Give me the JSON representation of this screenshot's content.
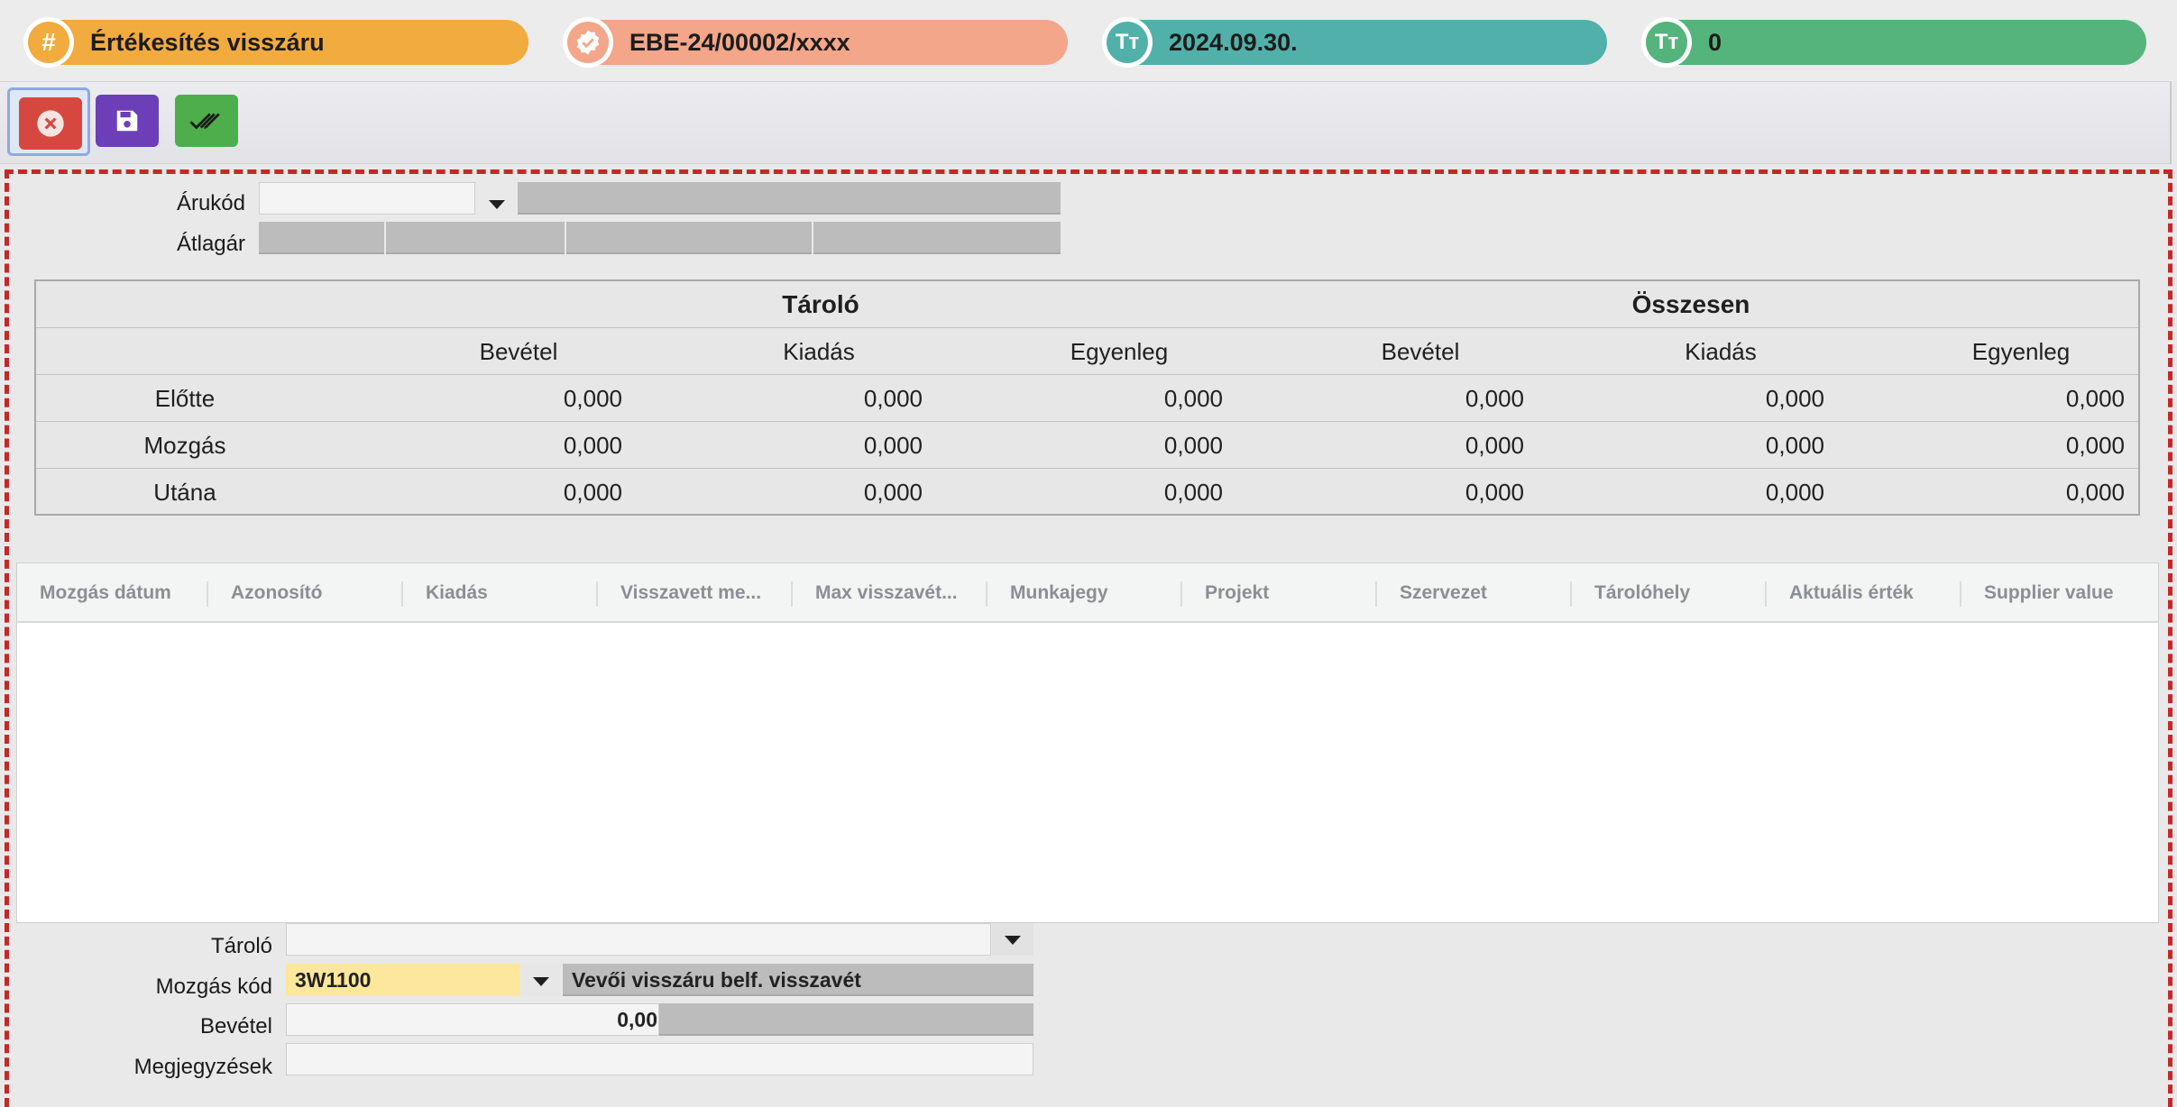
{
  "header": {
    "doc_type": "Értékesítés visszáru",
    "doc_number": "EBE-24/00002/xxxx",
    "date": "2024.09.30.",
    "count": "0",
    "colors": {
      "doc_type": "#f2ab3f",
      "doc_number": "#f3a68a",
      "date": "#52b0aa",
      "count": "#55b47b"
    },
    "icons": [
      "hash-icon",
      "verified-badge-icon",
      "text-size-icon",
      "text-size-icon"
    ],
    "icon_glyphs": {
      "hash": "#",
      "tt": "Tт"
    }
  },
  "toolbar": {
    "cancel_icon": "close-circle-icon",
    "save_icon": "save-icon",
    "done_icon": "double-check-icon"
  },
  "form_top": {
    "arukod_label": "Árukód",
    "arukod_value": "",
    "arukod_name": "",
    "atlagar_label": "Átlagár"
  },
  "stats": {
    "group_headers": [
      "Tároló",
      "Összesen"
    ],
    "col_headers": [
      "Bevétel",
      "Kiadás",
      "Egyenleg",
      "Bevétel",
      "Kiadás",
      "Egyenleg"
    ],
    "rows": [
      {
        "label": "Előtte",
        "values": [
          "0,000",
          "0,000",
          "0,000",
          "0,000",
          "0,000",
          "0,000"
        ]
      },
      {
        "label": "Mozgás",
        "values": [
          "0,000",
          "0,000",
          "0,000",
          "0,000",
          "0,000",
          "0,000"
        ]
      },
      {
        "label": "Utána",
        "values": [
          "0,000",
          "0,000",
          "0,000",
          "0,000",
          "0,000",
          "0,000"
        ]
      }
    ]
  },
  "grid": {
    "columns": [
      "Mozgás dátum",
      "Azonosító",
      "Kiadás",
      "Visszavett me...",
      "Max visszavét...",
      "Munkajegy",
      "Projekt",
      "Szervezet",
      "Tárolóhely",
      "Aktuális érték",
      "Supplier value"
    ]
  },
  "form_bottom": {
    "tarolo_label": "Tároló",
    "tarolo_value": "",
    "mozgas_kod_label": "Mozgás kód",
    "mozgas_kod_value": "3W1100",
    "mozgas_kod_desc": "Vevői visszáru belf. visszavét",
    "bevetel_label": "Bevétel",
    "bevetel_value": "0,00",
    "megjegyzesek_label": "Megjegyzések",
    "megjegyzesek_value": "",
    "highlight_color": "#fde79c"
  }
}
